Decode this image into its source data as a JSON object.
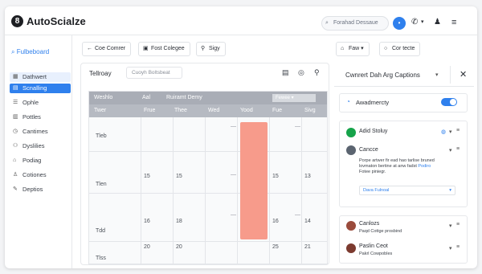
{
  "app": {
    "logo_glyph": "8",
    "brand": "AutoScialze"
  },
  "topbar": {
    "search_placeholder": "Forahad Dessaue",
    "avatar_initial": "•",
    "icons": [
      "phone-icon",
      "chevron-down-icon",
      "user-icon",
      "menu-icon"
    ]
  },
  "sidebar": {
    "dashboard": "Fulbeboard",
    "items": [
      {
        "label": "Dathwert",
        "icon": "grid-icon",
        "state": "soft"
      },
      {
        "label": "Scnalling",
        "icon": "calendar-icon",
        "state": "active"
      },
      {
        "label": "Ophle",
        "icon": "list-icon",
        "state": ""
      },
      {
        "label": "Pottles",
        "icon": "chart-icon",
        "state": ""
      },
      {
        "label": "Cantimes",
        "icon": "clock-icon",
        "state": ""
      },
      {
        "label": "Dyslilies",
        "icon": "people-icon",
        "state": ""
      },
      {
        "label": "Podiag",
        "icon": "tag-icon",
        "state": ""
      },
      {
        "label": "Cotiones",
        "icon": "user-icon",
        "state": ""
      },
      {
        "label": "Deptios",
        "icon": "wrench-icon",
        "state": ""
      }
    ]
  },
  "toolbar": {
    "btn1": "Coe Comrer",
    "btn2": "Fost Colegee",
    "btn3": "Sigy",
    "btn4": "Faw",
    "btn5": "Cor tecte"
  },
  "calendar": {
    "title": "Tellroay",
    "filter": "Cuoyh Boltsbeat",
    "head1": [
      "Weshlo",
      "Aal",
      "Ruiramt Demy"
    ],
    "head_dropdown": "Fewee",
    "head2": [
      "Twer",
      "Frue",
      "Thee",
      "Wed",
      "Yood",
      "Fue",
      "Sivg"
    ],
    "days": [
      "Tleb",
      "Tlen",
      "15",
      "15",
      "15",
      "13",
      "Tdd",
      "16",
      "18",
      "16",
      "14",
      "20",
      "20",
      "25",
      "Tlss",
      "21"
    ],
    "dash": "—"
  },
  "panel": {
    "title": "Cwnrert Dah Arg Captions",
    "toggle_label": "Awadmercty",
    "toggle_on": true,
    "card1_title": "Adid Stoluy",
    "post1_name": "Cancce",
    "post1_body_1": "Porpe artwer fir ead hao tarlise bruned",
    "post1_body_2": "lovmaton bertine at anw fadst",
    "post1_body_link": "Podiro",
    "post1_body_3": "Fotee piniegr.",
    "post1_input": "Dava Fulnoal",
    "post2_name": "Canlozs",
    "post2_body": "Paqd Cottge prosbind",
    "post3_name": "Paslin Ceot",
    "post3_body": "Pakrl Cowpobles"
  }
}
